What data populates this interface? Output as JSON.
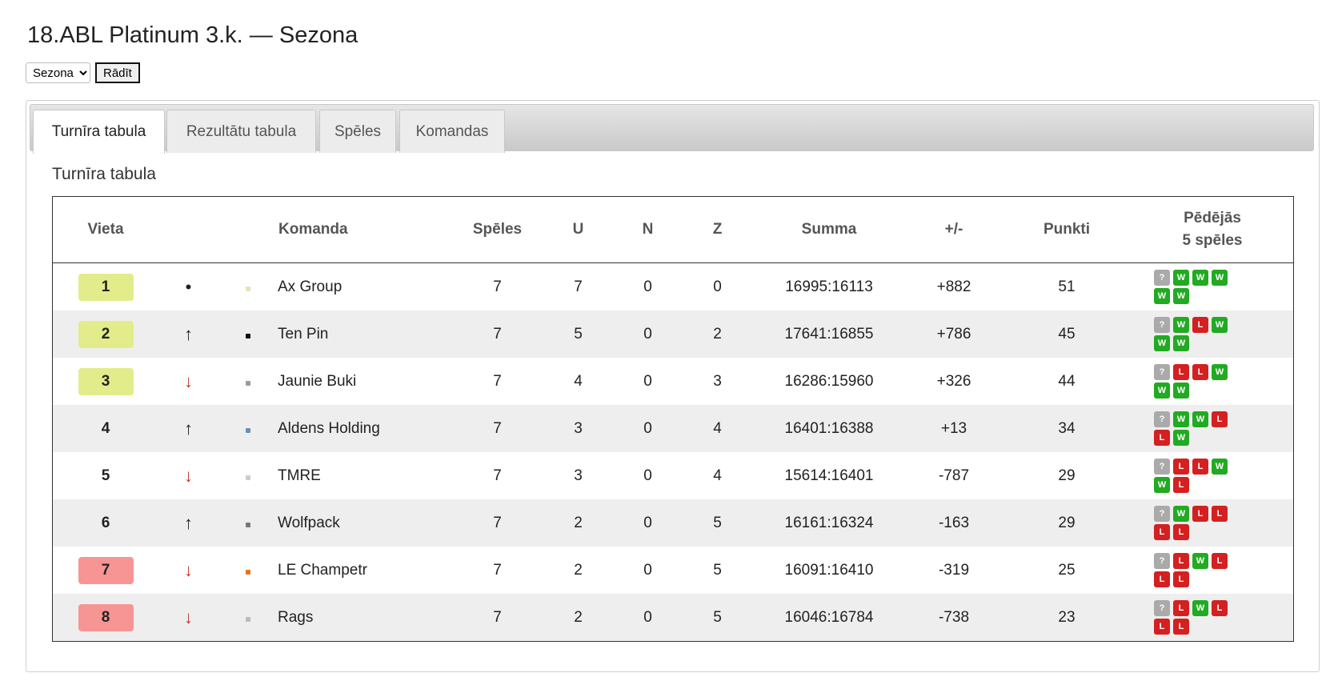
{
  "page": {
    "title": "18.ABL Platinum 3.k. — Sezona"
  },
  "controls": {
    "season_selected": "Sezona",
    "show_label": "Rādīt"
  },
  "tabs": [
    {
      "label": "Turnīra tabula",
      "active": true
    },
    {
      "label": "Rezultātu tabula",
      "active": false
    },
    {
      "label": "Spēles",
      "active": false
    },
    {
      "label": "Komandas",
      "active": false
    }
  ],
  "section": {
    "title": "Turnīra tabula"
  },
  "table": {
    "headers": {
      "place": "Vieta",
      "team": "Komanda",
      "games": "Spēles",
      "won": "U",
      "draw": "N",
      "lost": "Z",
      "sum": "Summa",
      "diff": "+/-",
      "points": "Punkti",
      "last5_line1": "Pēdējās",
      "last5_line2": "5 spēles"
    },
    "rows": [
      {
        "place": "1",
        "trend": "•",
        "logo_color": "#e8e3b8",
        "team": "Ax Group",
        "games": "7",
        "won": "7",
        "draw": "0",
        "lost": "0",
        "sum": "16995:16113",
        "diff": "+882",
        "points": "51",
        "form": [
          "?",
          "W",
          "W",
          "W",
          "W",
          "W"
        ]
      },
      {
        "place": "2",
        "trend": "↑",
        "logo_color": "#111111",
        "team": "Ten Pin",
        "games": "7",
        "won": "5",
        "draw": "0",
        "lost": "2",
        "sum": "17641:16855",
        "diff": "+786",
        "points": "45",
        "form": [
          "?",
          "W",
          "L",
          "W",
          "W",
          "W"
        ]
      },
      {
        "place": "3",
        "trend": "↓",
        "logo_color": "#9a9a9a",
        "team": "Jaunie Buki",
        "games": "7",
        "won": "4",
        "draw": "0",
        "lost": "3",
        "sum": "16286:15960",
        "diff": "+326",
        "points": "44",
        "form": [
          "?",
          "L",
          "L",
          "W",
          "W",
          "W"
        ]
      },
      {
        "place": "4",
        "trend": "↑",
        "logo_color": "#6c8fb6",
        "team": "Aldens Holding",
        "games": "7",
        "won": "3",
        "draw": "0",
        "lost": "4",
        "sum": "16401:16388",
        "diff": "+13",
        "points": "34",
        "form": [
          "?",
          "W",
          "W",
          "L",
          "L",
          "W"
        ]
      },
      {
        "place": "5",
        "trend": "↓",
        "logo_color": "#cccccc",
        "team": "TMRE",
        "games": "7",
        "won": "3",
        "draw": "0",
        "lost": "4",
        "sum": "15614:16401",
        "diff": "-787",
        "points": "29",
        "form": [
          "?",
          "L",
          "L",
          "W",
          "W",
          "L"
        ]
      },
      {
        "place": "6",
        "trend": "↑",
        "logo_color": "#777777",
        "team": "Wolfpack",
        "games": "7",
        "won": "2",
        "draw": "0",
        "lost": "5",
        "sum": "16161:16324",
        "diff": "-163",
        "points": "29",
        "form": [
          "?",
          "W",
          "L",
          "L",
          "L",
          "L"
        ]
      },
      {
        "place": "7",
        "trend": "↓",
        "logo_color": "#e8741c",
        "team": "LE Champetr",
        "games": "7",
        "won": "2",
        "draw": "0",
        "lost": "5",
        "sum": "16091:16410",
        "diff": "-319",
        "points": "25",
        "form": [
          "?",
          "L",
          "W",
          "L",
          "L",
          "L"
        ]
      },
      {
        "place": "8",
        "trend": "↓",
        "logo_color": "#bbbbbb",
        "team": "Rags",
        "games": "7",
        "won": "2",
        "draw": "0",
        "lost": "5",
        "sum": "16046:16784",
        "diff": "-738",
        "points": "23",
        "form": [
          "?",
          "L",
          "W",
          "L",
          "L",
          "L"
        ]
      }
    ]
  },
  "colors": {
    "promotion": "#e3ec8a",
    "relegation": "#f79595",
    "win": "#22aa22",
    "loss": "#d42020",
    "unknown": "#aaaaaa"
  }
}
